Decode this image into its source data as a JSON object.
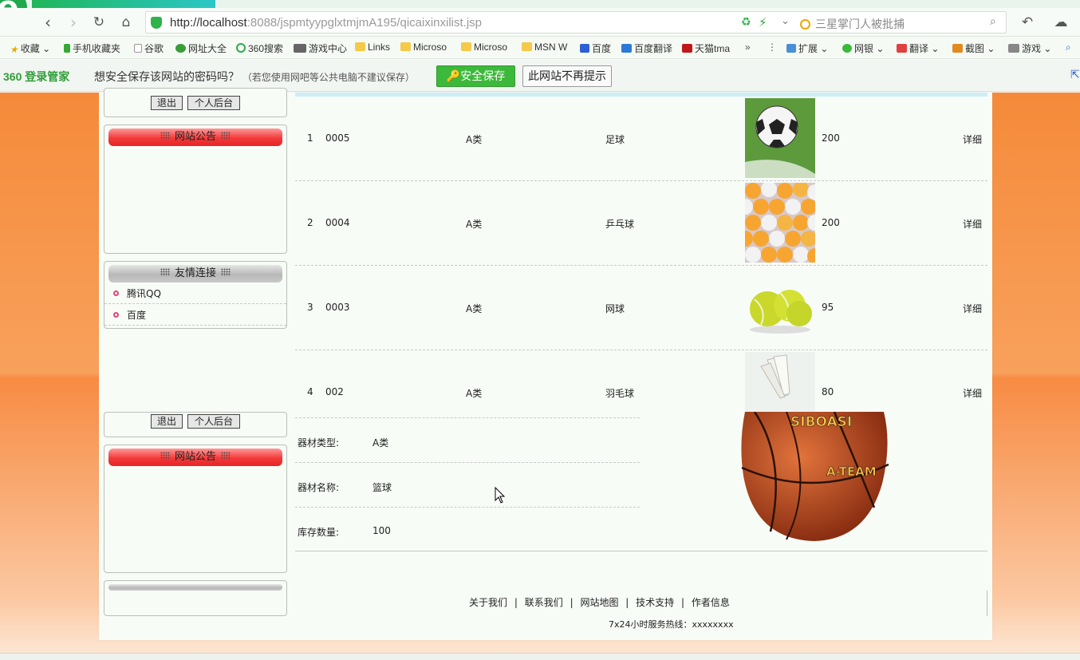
{
  "browser": {
    "logo_text": "e",
    "url_host": "http://localhost",
    "url_rest": ":8088/jspmtyypglxtmjmA195/qicaixinxilist.jsp",
    "search_hint": "三星掌门人被批捕"
  },
  "bookmarks": [
    "收藏",
    "手机收藏夹",
    "谷歌",
    "网址大全",
    "360搜索",
    "游戏中心",
    "Links",
    "Microso",
    "Microso",
    "MSN W",
    "百度",
    "百度翻译",
    "天猫tma",
    "扩展",
    "网银",
    "翻译",
    "截图",
    "游戏"
  ],
  "password_bar": {
    "logo": "360 登录管家",
    "message": "想安全保存该网站的密码吗？",
    "note": "（若您使用网吧等公共电脑不建议保存）",
    "save_label": "安全保存",
    "never_label": "此网站不再提示"
  },
  "sidebar": {
    "logout_label": "退出",
    "backend_label": "个人后台",
    "notice_title": "网站公告",
    "links_title": "友情连接",
    "links": [
      "腾讯QQ",
      "百度"
    ]
  },
  "equipment_list": [
    {
      "index": "1",
      "code": "0005",
      "category": "A类",
      "name": "足球",
      "image": "soccer-ball",
      "stock": "200",
      "action": "详细"
    },
    {
      "index": "2",
      "code": "0004",
      "category": "A类",
      "name": "乒乓球",
      "image": "ping-pong-balls",
      "stock": "200",
      "action": "详细"
    },
    {
      "index": "3",
      "code": "0003",
      "category": "A类",
      "name": "网球",
      "image": "tennis-balls",
      "stock": "95",
      "action": "详细"
    },
    {
      "index": "4",
      "code": "002",
      "category": "A类",
      "name": "羽毛球",
      "image": "shuttlecock",
      "stock": "80",
      "action": "详细"
    }
  ],
  "detail": {
    "category_label": "器材类型:",
    "category_value": "A类",
    "name_label": "器材名称:",
    "name_value": "篮球",
    "stock_label": "库存数量:",
    "stock_value": "100",
    "ball_brand": "SIBOASI",
    "ball_model": "A-TEAM"
  },
  "footer": {
    "links": [
      "关于我们",
      "联系我们",
      "网站地图",
      "技术支持",
      "作者信息"
    ],
    "hotline": "7x24小时服务热线：xxxxxxxx"
  },
  "colors": {
    "accent_green": "#3cb93a",
    "header_red": "#f23a3a",
    "bg_orange": "#f58a3a"
  }
}
